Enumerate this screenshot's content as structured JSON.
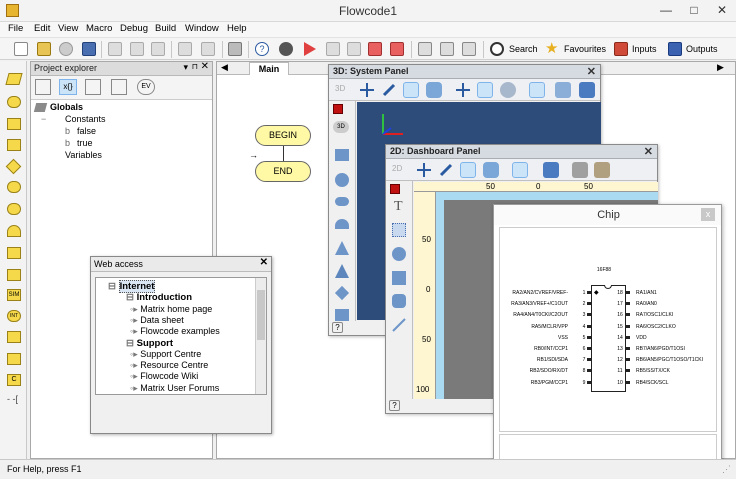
{
  "window": {
    "title": "Flowcode1",
    "minimize": "—",
    "maximize": "□",
    "close": "✕"
  },
  "menu": [
    "File",
    "Edit",
    "View",
    "Macro",
    "Debug",
    "Build",
    "Window",
    "Help"
  ],
  "toolbar": {
    "search": "Search",
    "favourites": "Favourites",
    "inputs": "Inputs",
    "outputs": "Outputs"
  },
  "project_explorer": {
    "title": "Project explorer",
    "globals": "Globals",
    "constants": "Constants",
    "const_false": "false",
    "const_true": "true",
    "variables": "Variables",
    "tab_ev": "EV"
  },
  "main": {
    "tab": "Main",
    "begin": "BEGIN",
    "end": "END"
  },
  "panel_3d": {
    "title": "3D: System Panel",
    "label_3d": "3D"
  },
  "panel_2d": {
    "title": "2D: Dashboard Panel",
    "ruler_top": [
      "50",
      "0",
      "50",
      "100",
      "150"
    ],
    "ruler_left": [
      "50",
      "0",
      "50",
      "100"
    ]
  },
  "web_access": {
    "title": "Web access",
    "items": [
      {
        "label": "Internet",
        "level": 0,
        "bold": true
      },
      {
        "label": "Introduction",
        "level": 1,
        "bold": true
      },
      {
        "label": "Matrix home page",
        "level": 2,
        "bold": false
      },
      {
        "label": "Data sheet",
        "level": 2,
        "bold": false
      },
      {
        "label": "Flowcode examples",
        "level": 2,
        "bold": false
      },
      {
        "label": "Support",
        "level": 1,
        "bold": true
      },
      {
        "label": "Support Centre",
        "level": 2,
        "bold": false
      },
      {
        "label": "Resource Centre",
        "level": 2,
        "bold": false
      },
      {
        "label": "Flowcode Wiki",
        "level": 2,
        "bold": false
      },
      {
        "label": "Matrix User Forums",
        "level": 2,
        "bold": false
      }
    ]
  },
  "chip": {
    "title": "Chip",
    "model": "16F88",
    "left_pins": [
      "RA2/AN2/CVREF/VREF-",
      "RA3/AN3/VREF+/C1OUT",
      "RA4/AN4/T0CKI/C2OUT",
      "RA5/MCLR/VPP",
      "VSS",
      "RB0/INT/CCP1",
      "RB1/SDI/SDA",
      "RB2/SDO/RX/DT",
      "RB3/PGM/CCP1"
    ],
    "right_pins": [
      "RA1/AN1",
      "RA0/AN0",
      "RA7/OSC1/CLKI",
      "RA6/OSC2/CLKO",
      "VDD",
      "RB7/AN6/PGD/T1OSI",
      "RB6/AN5/PGC/T1OSO/T1CKI",
      "RB5/SS/TX/CK",
      "RB4/SCK/SCL"
    ],
    "left_nums": [
      "1",
      "2",
      "3",
      "4",
      "5",
      "6",
      "7",
      "8",
      "9"
    ],
    "right_nums": [
      "18",
      "17",
      "16",
      "15",
      "14",
      "13",
      "12",
      "11",
      "10"
    ]
  },
  "status": {
    "text": "For Help, press F1"
  },
  "colors": {
    "panel_blue": "#2e4c7a",
    "dashboard_bg": "#aadaf2",
    "dashboard_inner": "#7a7a7a",
    "flow_fill": "#fff9a6"
  }
}
